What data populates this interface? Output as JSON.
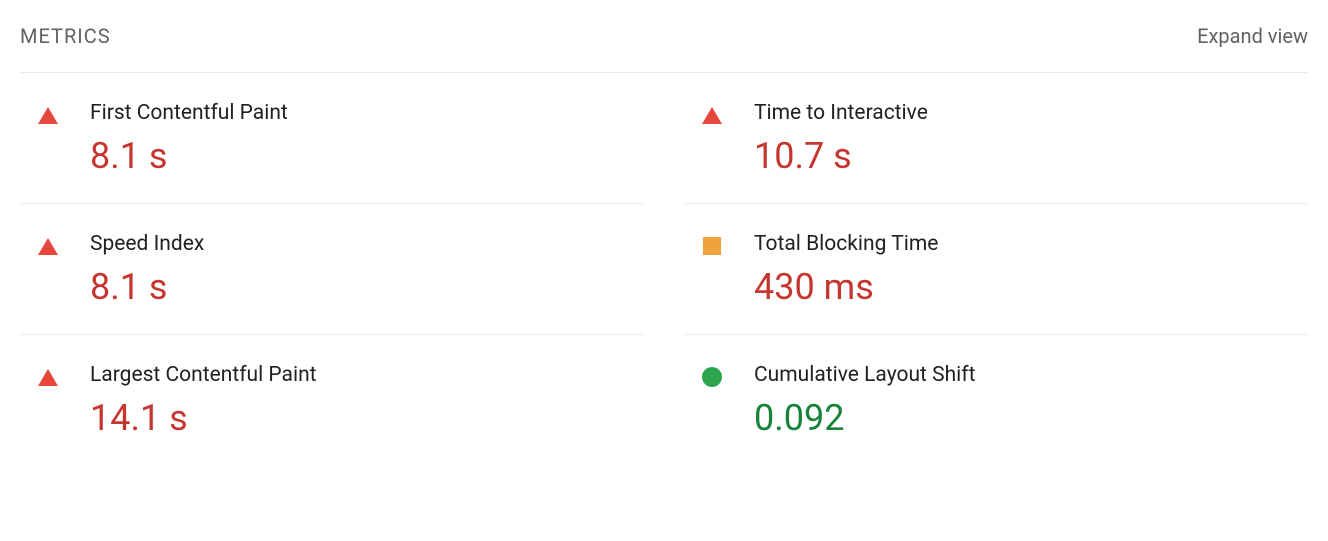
{
  "header": {
    "title": "METRICS",
    "expand_label": "Expand view"
  },
  "metrics": [
    {
      "label": "First Contentful Paint",
      "value": "8.1 s",
      "status": "fail"
    },
    {
      "label": "Time to Interactive",
      "value": "10.7 s",
      "status": "fail"
    },
    {
      "label": "Speed Index",
      "value": "8.1 s",
      "status": "fail"
    },
    {
      "label": "Total Blocking Time",
      "value": "430 ms",
      "status": "warn"
    },
    {
      "label": "Largest Contentful Paint",
      "value": "14.1 s",
      "status": "fail"
    },
    {
      "label": "Cumulative Layout Shift",
      "value": "0.092",
      "status": "pass"
    }
  ],
  "colors": {
    "fail": "#C6362F",
    "warn": "#EFA33C",
    "pass": "#178239"
  }
}
